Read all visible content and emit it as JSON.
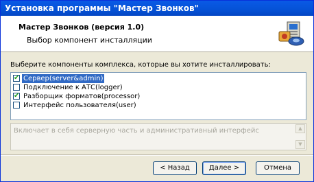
{
  "window": {
    "title": "Установка программы \"Мастер Звонков\""
  },
  "header": {
    "title": "Мастер Звонков (версия 1.0)",
    "subtitle": "Выбор компонент инсталляции",
    "icon": "installer-computer-icon"
  },
  "components": {
    "instruction": "Выберите компоненты комплекса, которые вы хотите инсталлировать:",
    "items": [
      {
        "label": "Сервер(server&admin)",
        "checked": true,
        "selected": true
      },
      {
        "label": "Подключение к АТС(logger)",
        "checked": false,
        "selected": false
      },
      {
        "label": "Разборщик форматов(processor)",
        "checked": true,
        "selected": false
      },
      {
        "label": "Интерфейс пользователя(user)",
        "checked": false,
        "selected": false
      }
    ]
  },
  "description": {
    "text": "Включает в себя серверную часть и административный интерфейс"
  },
  "buttons": {
    "back": "< Назад",
    "next": "Далее >",
    "cancel": "Отмена"
  },
  "colors": {
    "title_bar": "#0552d6",
    "selection": "#316ac5",
    "check": "#21a121"
  }
}
